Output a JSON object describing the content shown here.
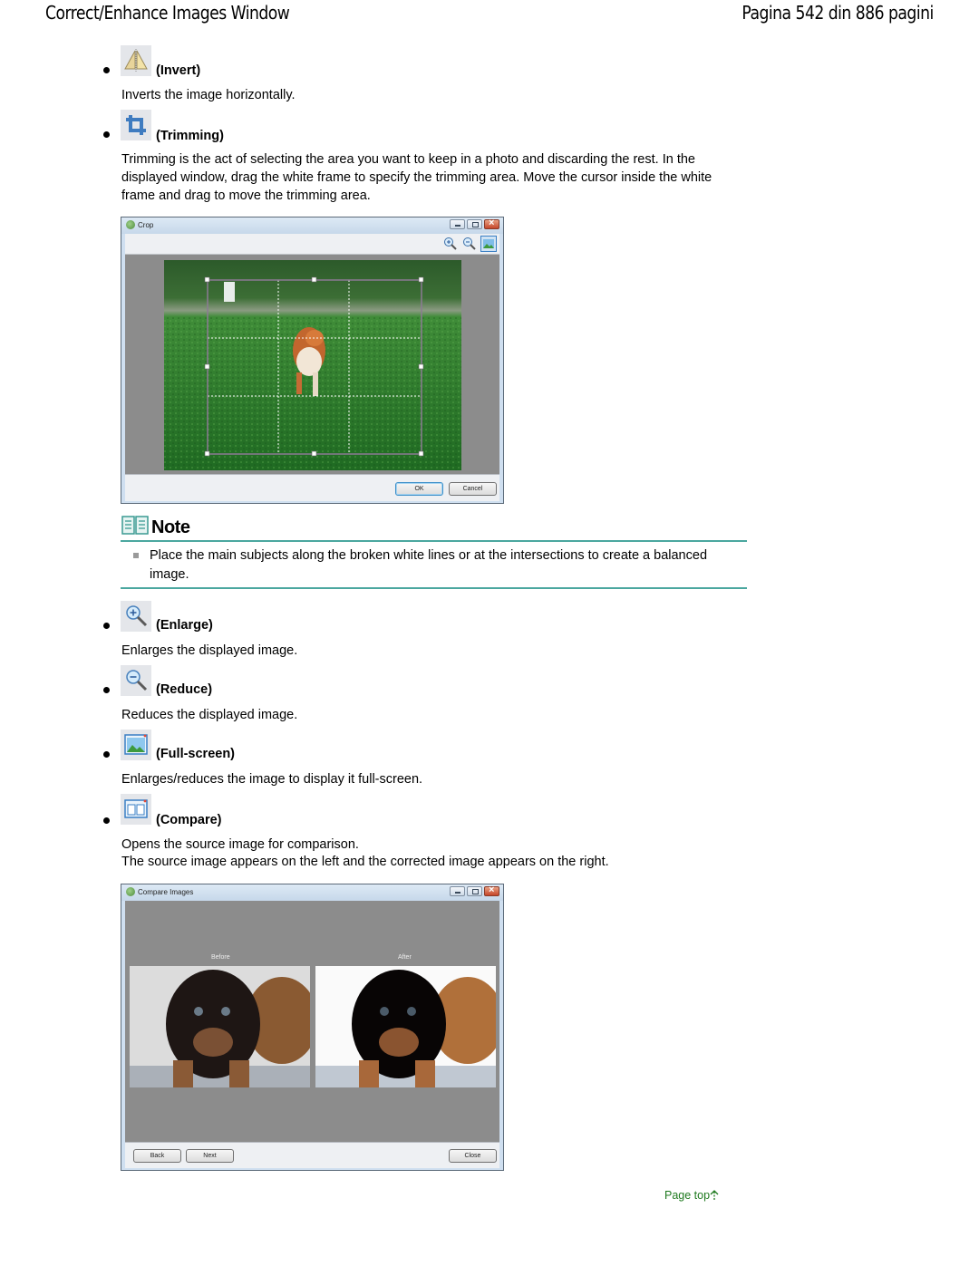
{
  "header": {
    "title": "Correct/Enhance Images Window",
    "page_info": "Pagina 542 din 886 pagini"
  },
  "items": [
    {
      "icon": "invert-icon",
      "label": "(Invert)",
      "description": "Inverts the image horizontally."
    },
    {
      "icon": "trimming-icon",
      "label": "(Trimming)",
      "description": "Trimming is the act of selecting the area you want to keep in a photo and discarding the rest. In the displayed window, drag the white frame to specify the trimming area. Move the cursor inside the white frame and drag to move the trimming area."
    },
    {
      "icon": "enlarge-icon",
      "label": "(Enlarge)",
      "description": "Enlarges the displayed image."
    },
    {
      "icon": "reduce-icon",
      "label": "(Reduce)",
      "description": "Reduces the displayed image."
    },
    {
      "icon": "full-screen-icon",
      "label": "(Full-screen)",
      "description": "Enlarges/reduces the image to display it full-screen."
    },
    {
      "icon": "compare-icon",
      "label": "(Compare)",
      "description_lines": [
        "Opens the source image for comparison.",
        "The source image appears on the left and the corrected image appears on the right."
      ]
    }
  ],
  "crop_window": {
    "title": "Crop",
    "toolbar": [
      "enlarge-icon",
      "reduce-icon",
      "full-screen-icon"
    ],
    "ok_label": "OK",
    "cancel_label": "Cancel"
  },
  "note": {
    "title": "Note",
    "text": "Place the main subjects along the broken white lines or at the intersections to create a balanced image."
  },
  "compare_window": {
    "title": "Compare Images",
    "before_label": "Before",
    "after_label": "After",
    "back_label": "Back",
    "next_label": "Next",
    "close_label": "Close"
  },
  "page_top": {
    "label": "Page top",
    "icon": "arrow-up-icon"
  }
}
